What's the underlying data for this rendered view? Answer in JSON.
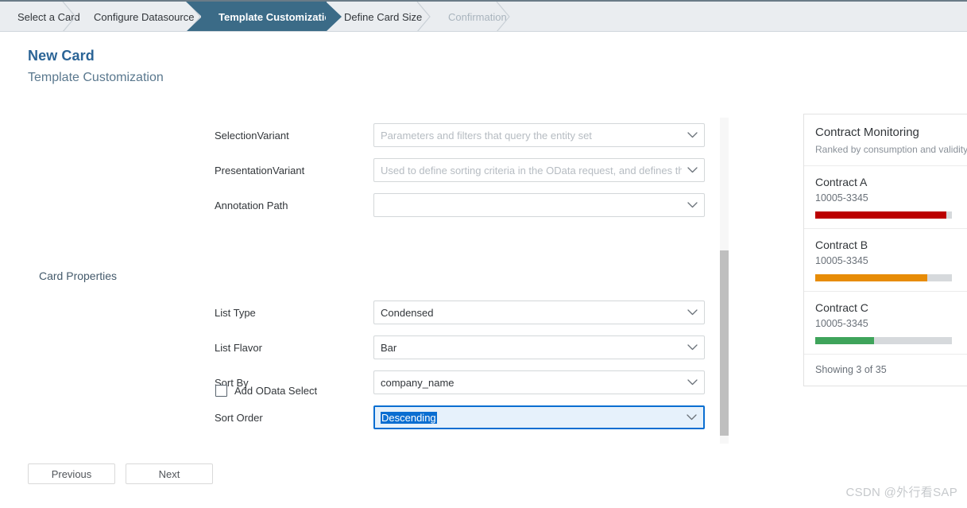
{
  "wizard": {
    "steps": [
      {
        "label": "Select a Card",
        "state": "done"
      },
      {
        "label": "Configure Datasource",
        "state": "done"
      },
      {
        "label": "Template Customization",
        "state": "active"
      },
      {
        "label": "Define Card Size",
        "state": "done"
      },
      {
        "label": "Confirmation",
        "state": "disabled"
      }
    ],
    "active_color": "#3b6b87",
    "bar_color": "#eaedf0"
  },
  "heading": {
    "title": "New Card",
    "subtitle": "Template Customization"
  },
  "form": {
    "section_label": "Card Properties",
    "fields": [
      {
        "label": "SelectionVariant",
        "value": "",
        "placeholder": "Parameters and filters that query the entity set",
        "state": "placeholder"
      },
      {
        "label": "PresentationVariant",
        "value": "",
        "placeholder": "Used to define sorting criteria in the OData request, and defines the w",
        "state": "placeholder"
      },
      {
        "label": "Annotation Path",
        "value": "",
        "placeholder": "",
        "state": "empty"
      },
      {
        "label": "List Type",
        "value": "Condensed",
        "placeholder": "",
        "state": "filled"
      },
      {
        "label": "List Flavor",
        "value": "Bar",
        "placeholder": "",
        "state": "filled"
      },
      {
        "label": "Sort By",
        "value": "company_name",
        "placeholder": "",
        "state": "filled"
      },
      {
        "label": "Sort Order",
        "value": "Descending",
        "placeholder": "",
        "state": "focused"
      }
    ],
    "checkbox": {
      "label": "Add OData Select",
      "checked": false
    }
  },
  "preview_card": {
    "title": "Contract Monitoring",
    "subtitle": "Ranked by consumption and validity",
    "items": [
      {
        "title": "Contract A",
        "subtitle": "10005-3345",
        "percent": 96,
        "color": "#bb0000"
      },
      {
        "title": "Contract B",
        "subtitle": "10005-3345",
        "percent": 82,
        "color": "#e78c07"
      },
      {
        "title": "Contract C",
        "subtitle": "10005-3345",
        "percent": 43,
        "color": "#3fa45b"
      }
    ],
    "footer": "Showing 3 of 35",
    "track_color": "#d6d9dc"
  },
  "footer": {
    "previous_label": "Previous",
    "next_label": "Next"
  },
  "watermark": "CSDN @外行看SAP"
}
